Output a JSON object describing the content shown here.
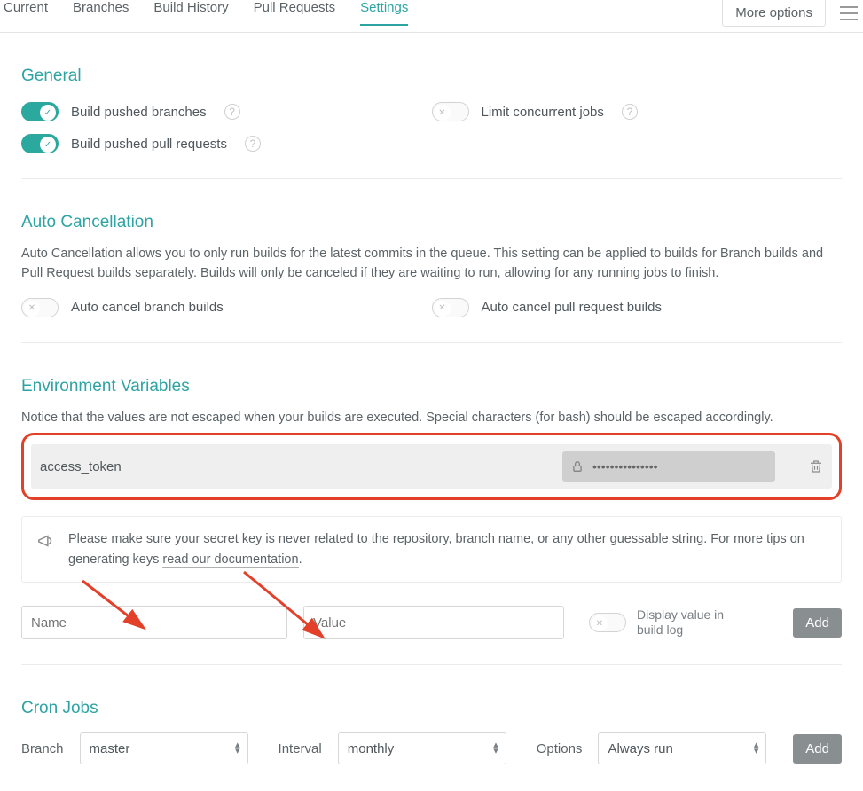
{
  "tabs": {
    "items": [
      "Current",
      "Branches",
      "Build History",
      "Pull Requests",
      "Settings"
    ],
    "active": "Settings"
  },
  "top_right": {
    "more_options": "More options"
  },
  "sections": {
    "general": {
      "title": "General",
      "opts": {
        "build_pushed_branches": {
          "label": "Build pushed branches",
          "on": true,
          "help": true
        },
        "limit_concurrent_jobs": {
          "label": "Limit concurrent jobs",
          "on": false,
          "help": true
        },
        "build_pushed_prs": {
          "label": "Build pushed pull requests",
          "on": true,
          "help": true
        }
      }
    },
    "auto_cancel": {
      "title": "Auto Cancellation",
      "desc": "Auto Cancellation allows you to only run builds for the latest commits in the queue. This setting can be applied to builds for Branch builds and Pull Request builds separately. Builds will only be canceled if they are waiting to run, allowing for any running jobs to finish.",
      "opts": {
        "branch": {
          "label": "Auto cancel branch builds",
          "on": false
        },
        "pr": {
          "label": "Auto cancel pull request builds",
          "on": false
        }
      }
    },
    "env": {
      "title": "Environment Variables",
      "notice": "Notice that the values are not escaped when your builds are executed. Special characters (for bash) should be escaped accordingly.",
      "vars": [
        {
          "name": "access_token",
          "masked_value": "•••••••••••••••",
          "locked": true
        }
      ],
      "tip_prefix": "Please make sure your secret key is never related to the repository, branch name, or any other guessable string. For more tips on generating keys ",
      "tip_link": "read our documentation",
      "tip_suffix": ".",
      "name_placeholder": "Name",
      "value_placeholder": "Value",
      "display_toggle_label": "Display value in build log",
      "add_button": "Add"
    },
    "cron": {
      "title": "Cron Jobs",
      "branch_label": "Branch",
      "branch_value": "master",
      "interval_label": "Interval",
      "interval_value": "monthly",
      "options_label": "Options",
      "options_value": "Always run",
      "add_button": "Add"
    }
  }
}
